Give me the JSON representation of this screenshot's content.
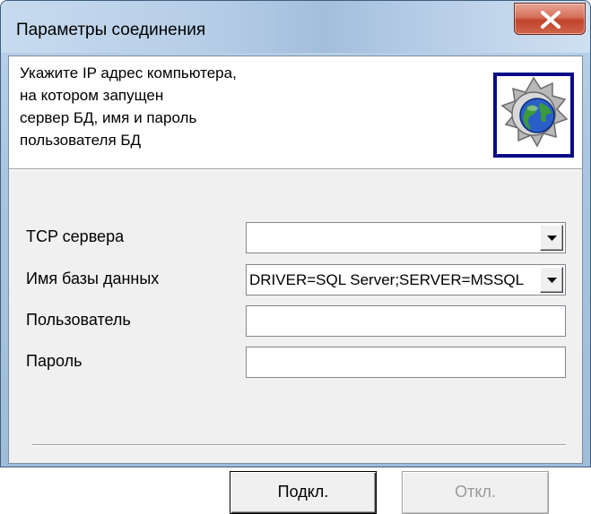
{
  "window": {
    "title": "Параметры соединения",
    "close_icon": "close-x-icon"
  },
  "header": {
    "lines": [
      "Укажите IP адрес компьютера,",
      "на котором запущен",
      "сервер БД, имя и пароль",
      "пользователя БД"
    ],
    "icon": "globe-network-icon"
  },
  "form": {
    "tcp_server": {
      "label": "TCP сервера",
      "value": ""
    },
    "database_name": {
      "label": "Имя базы данных",
      "value": "DRIVER=SQL Server;SERVER=MSSQL"
    },
    "user": {
      "label": "Пользователь",
      "value": ""
    },
    "password": {
      "label": "Пароль",
      "value": ""
    }
  },
  "buttons": {
    "connect": "Подкл.",
    "disconnect": "Откл."
  },
  "colors": {
    "accent_frame": "#0a0a86",
    "close_button": "#c0432b",
    "dialog_background": "#f0f0f0"
  }
}
